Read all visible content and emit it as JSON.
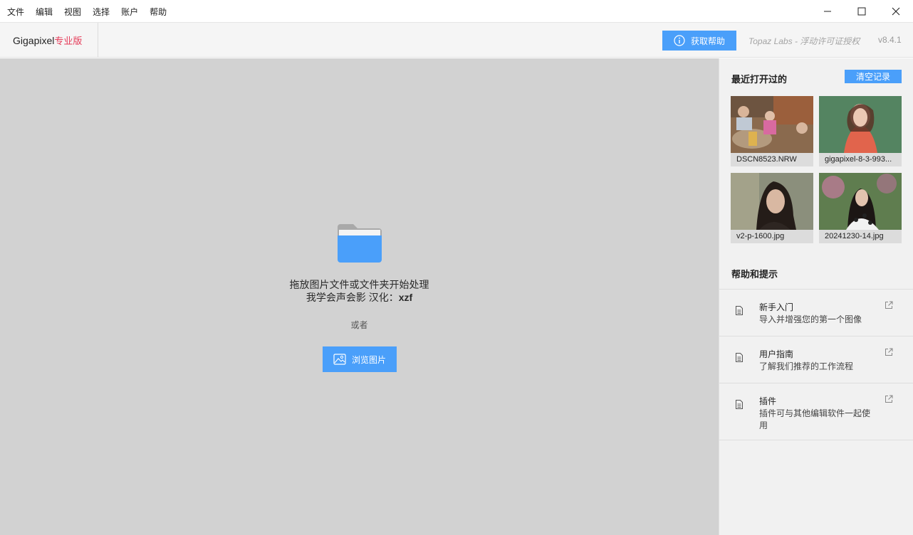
{
  "menu": {
    "items": [
      "文件",
      "编辑",
      "视图",
      "选择",
      "账户",
      "帮助"
    ]
  },
  "window_controls": {
    "minimize": "minimize-icon",
    "maximize": "maximize-icon",
    "close": "close-icon"
  },
  "header": {
    "brand_name": "Gigapixel",
    "brand_edition": "专业版",
    "help_button": "获取帮助",
    "license_text": "Topaz Labs - 浮动许可证授权",
    "version": "v8.4.1"
  },
  "main": {
    "drop_line1": "拖放图片文件或文件夹开始处理",
    "drop_line2_prefix": "我学会声会影 汉化：",
    "drop_line2_bold": "xzf",
    "or_text": "或者",
    "browse_button": "浏览图片"
  },
  "sidebar": {
    "recent_title": "最近打开过的",
    "clear_button": "清空记录",
    "recent_files": [
      {
        "name": "DSCN8523.NRW"
      },
      {
        "name": "gigapixel-8-3-993..."
      },
      {
        "name": "v2-p-1600.jpg"
      },
      {
        "name": "20241230-14.jpg"
      }
    ],
    "help_title": "帮助和提示",
    "help_items": [
      {
        "title": "新手入门",
        "desc": "导入并增强您的第一个图像"
      },
      {
        "title": "用户指南",
        "desc": "了解我们推荐的工作流程"
      },
      {
        "title": "插件",
        "desc": "插件可与其他编辑软件一起使用"
      }
    ]
  },
  "colors": {
    "accent": "#4a9ffa",
    "edition": "#e53a58",
    "canvas": "#d2d2d2",
    "sidebar": "#f1f1f1"
  }
}
